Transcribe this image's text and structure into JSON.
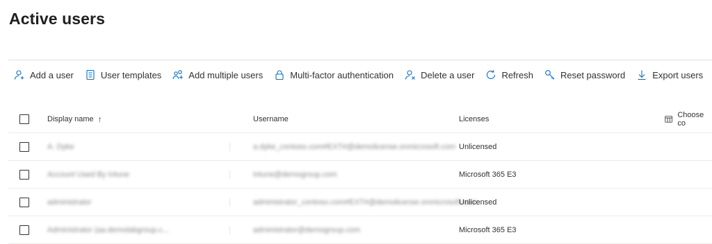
{
  "page": {
    "title": "Active users"
  },
  "toolbar": {
    "items": [
      {
        "label": "Add a user",
        "icon": "add-user-icon"
      },
      {
        "label": "User templates",
        "icon": "template-icon"
      },
      {
        "label": "Add multiple users",
        "icon": "add-multiple-users-icon"
      },
      {
        "label": "Multi-factor authentication",
        "icon": "lock-icon"
      },
      {
        "label": "Delete a user",
        "icon": "delete-user-icon"
      },
      {
        "label": "Refresh",
        "icon": "refresh-icon"
      },
      {
        "label": "Reset password",
        "icon": "key-icon"
      },
      {
        "label": "Export users",
        "icon": "download-icon"
      }
    ],
    "more_label": "···"
  },
  "table": {
    "columns": {
      "display_name": "Display name",
      "sort_indicator": "↑",
      "username": "Username",
      "licenses": "Licenses",
      "choose_columns": "Choose co"
    },
    "rows": [
      {
        "display_name": "A. Dyke",
        "username": "a.dyke_contoso.com#EXT#@demolicense.onmicrosoft.com",
        "licenses": "Unlicensed"
      },
      {
        "display_name": "Account Used By Intune",
        "username": "intune@demogroup.com",
        "licenses": "Microsoft 365 E3"
      },
      {
        "display_name": "administrator",
        "username": "administrator_contoso.com#EXT#@demolicense.onmicrosoft.com",
        "licenses": "Unlicensed"
      },
      {
        "display_name": "Administrator (aa.demolabgroup.c...",
        "username": "administrator@demogroup.com",
        "licenses": "Microsoft 365 E3"
      }
    ]
  }
}
